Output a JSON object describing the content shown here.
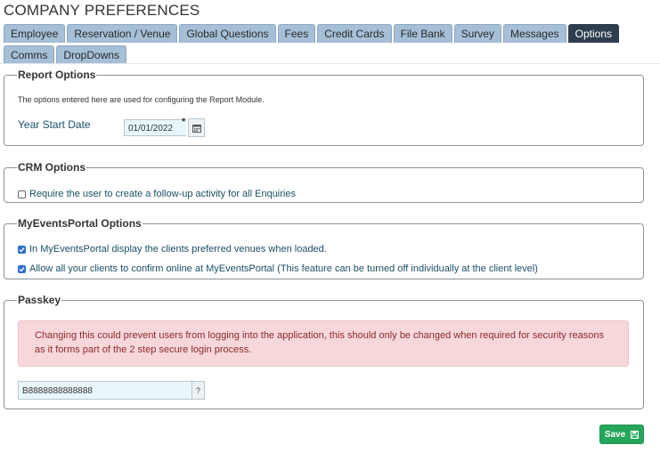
{
  "page_title": "COMPANY PREFERENCES",
  "tabs": [
    {
      "label": "Employee",
      "active": false
    },
    {
      "label": "Reservation / Venue",
      "active": false
    },
    {
      "label": "Global Questions",
      "active": false
    },
    {
      "label": "Fees",
      "active": false
    },
    {
      "label": "Credit Cards",
      "active": false
    },
    {
      "label": "File Bank",
      "active": false
    },
    {
      "label": "Survey",
      "active": false
    },
    {
      "label": "Messages",
      "active": false
    },
    {
      "label": "Options",
      "active": true
    },
    {
      "label": "Comms",
      "active": false
    },
    {
      "label": "DropDowns",
      "active": false
    }
  ],
  "report_options": {
    "legend": "Report Options",
    "description": "The options entered here are used for configuring the Report Module.",
    "year_start_label": "Year Start Date",
    "year_start_value": "01/01/2022",
    "required_marker": "*"
  },
  "crm_options": {
    "legend": "CRM Options",
    "followup_label": "Require the user to create a follow-up activity for all Enquiries",
    "followup_checked": false
  },
  "mep_options": {
    "legend": "MyEventsPortal Options",
    "preferred_venues_label": "In MyEventsPortal display the clients preferred venues when loaded.",
    "preferred_venues_checked": true,
    "confirm_online_label": "Allow all your clients to confirm online at MyEventsPortal (This feature can be turned off individually at the client level)",
    "confirm_online_checked": true
  },
  "passkey": {
    "legend": "Passkey",
    "warning": "Changing this could prevent users from logging into the application, this should only be changed when required for security reasons as it forms part of the 2 step secure login process.",
    "value": "B8888888888888",
    "help_label": "?"
  },
  "save_label": "Save",
  "icons": {
    "calendar": "calendar-icon",
    "save": "floppy-disk-icon",
    "check": "check-icon"
  },
  "colors": {
    "tab_bg": "#a5bfd6",
    "tab_active_bg": "#2f3e4e",
    "alert_bg": "#f8d7da",
    "save_bg": "#26a65b",
    "checkbox_checked": "#2f6fd0"
  }
}
